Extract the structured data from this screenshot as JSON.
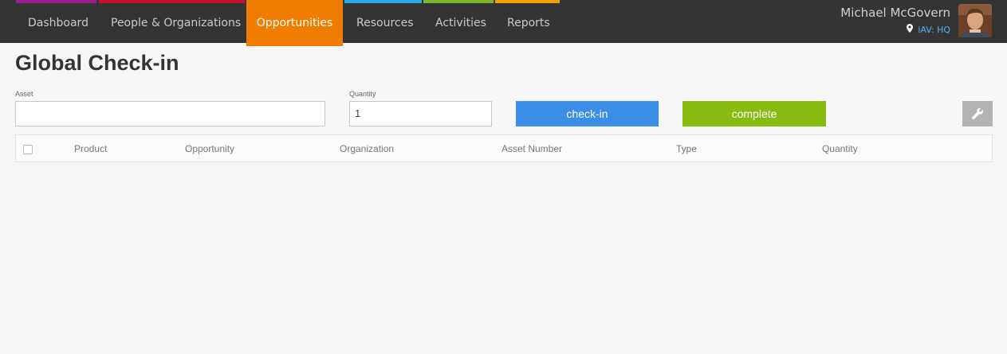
{
  "nav": {
    "items": [
      {
        "label": "Dashboard"
      },
      {
        "label": "People & Organizations"
      },
      {
        "label": "Opportunities"
      },
      {
        "label": "Resources"
      },
      {
        "label": "Activities"
      },
      {
        "label": "Reports"
      }
    ],
    "active_color": "#f07d00",
    "strip_colors": [
      "#9b1f8e",
      "#c8102e",
      "#2aa7e6",
      "#7ab82a",
      "#f0a000"
    ]
  },
  "user": {
    "name": "Michael McGovern",
    "location": "iAV: HQ",
    "location_icon": "map-pin-icon",
    "avatar": "user-avatar"
  },
  "page": {
    "title": "Global Check-in"
  },
  "form": {
    "asset_label": "Asset",
    "asset_value": "",
    "quantity_label": "Quantity",
    "quantity_value": "1",
    "checkin_label": "check-in",
    "checkin_color": "#3a8ee6",
    "complete_label": "complete",
    "complete_color": "#86bc10",
    "tool_icon": "wrench-icon"
  },
  "table": {
    "columns": [
      "Product",
      "Opportunity",
      "Organization",
      "Asset Number",
      "Type",
      "Quantity"
    ],
    "rows": []
  }
}
